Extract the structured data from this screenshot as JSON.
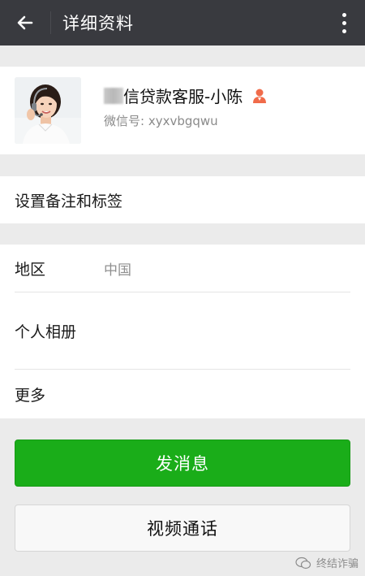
{
  "header": {
    "title": "详细资料",
    "back_icon": "arrow-left-icon",
    "more_icon": "more-vertical-icon",
    "background": "#393a3f"
  },
  "profile": {
    "name": "信贷款客服-小陈",
    "wechat_id_label": "微信号:",
    "wechat_id": "xyxvbgqwu",
    "gender_icon": "person-icon",
    "gender_color": "#f06b4a"
  },
  "rows": {
    "remark": "设置备注和标签",
    "region_label": "地区",
    "region_value": "中国",
    "album_label": "个人相册",
    "more_label": "更多"
  },
  "actions": {
    "send_message": "发消息",
    "video_call": "视频通话",
    "primary_color": "#1aad19"
  },
  "watermark": {
    "text": "终结诈骗"
  }
}
